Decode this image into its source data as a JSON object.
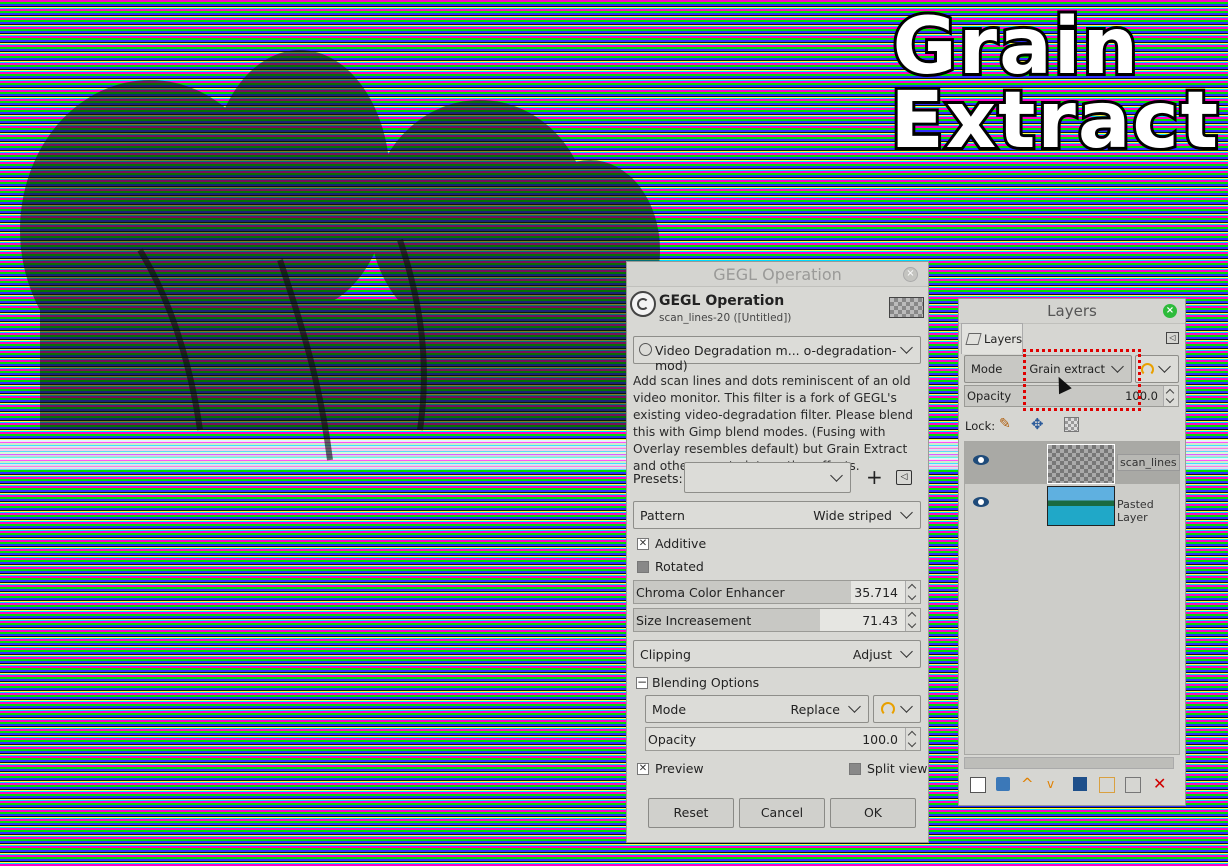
{
  "canvas_title": {
    "line1": "Grain",
    "line2": "Extract"
  },
  "gegl": {
    "window_title": "GEGL Operation",
    "header_title": "GEGL Operation",
    "header_sub": "scan_lines-20 ([Untitled])",
    "operation": "Video Degradation m... o-degradation-mod)",
    "description": "Add scan lines and dots reminiscent of an old video monitor. This filter is a fork of GEGL's existing video-degradation filter. Please blend this with Gimp blend modes. (Fusing with Overlay resembles default) but Grain Extract and others create interesting effects.",
    "presets_label": "Presets:",
    "pattern_label": "Pattern",
    "pattern_value": "Wide striped",
    "additive_label": "Additive",
    "additive_checked": true,
    "rotated_label": "Rotated",
    "rotated_checked": false,
    "chroma_label": "Chroma Color Enhancer",
    "chroma_value": "35.714",
    "chroma_fill": 0.76,
    "size_label": "Size Increasement",
    "size_value": "71.43",
    "size_fill": 0.65,
    "clipping_label": "Clipping",
    "clipping_value": "Adjust",
    "blending_label": "Blending Options",
    "mode_label": "Mode",
    "mode_value": "Replace",
    "opacity_label": "Opacity",
    "opacity_value": "100.0",
    "preview_label": "Preview",
    "split_label": "Split view",
    "reset": "Reset",
    "cancel": "Cancel",
    "ok": "OK"
  },
  "layers": {
    "title": "Layers",
    "tab": "Layers",
    "mode_label": "Mode",
    "mode_value": "Grain extract",
    "opacity_label": "Opacity",
    "opacity_value": "100.0",
    "lock_label": "Lock:",
    "items": [
      {
        "name": "scan_lines"
      },
      {
        "name": "Pasted Layer"
      }
    ]
  }
}
